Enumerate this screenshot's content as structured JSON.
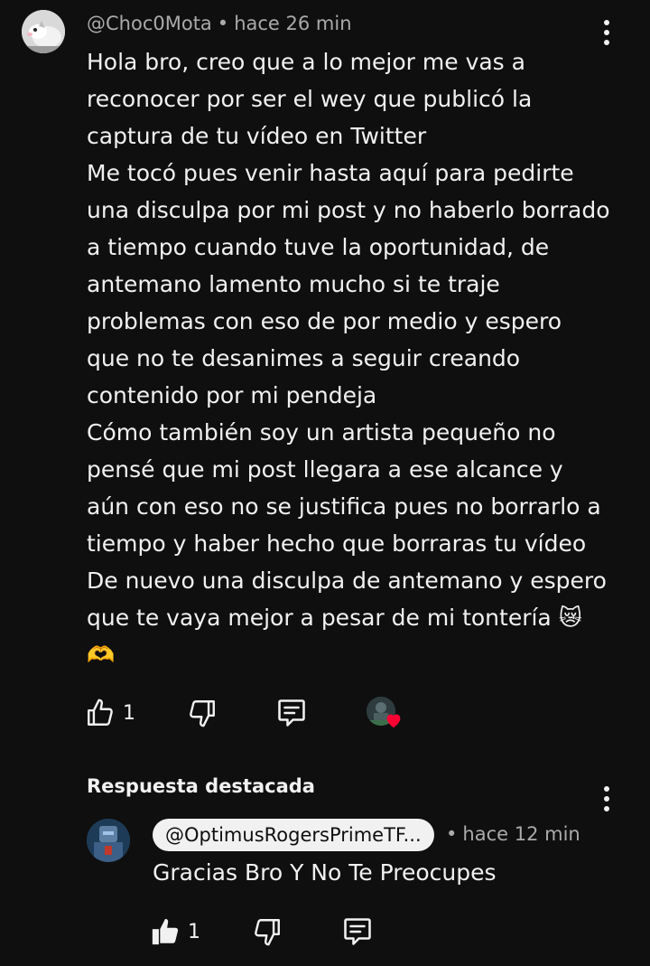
{
  "comment": {
    "author": "@Choc0Mota",
    "separator": "•",
    "time": "hace 26 min",
    "text": "Hola bro, creo que a lo mejor me vas a\nreconocer por ser el wey que publicó la\ncaptura de tu vídeo en Twitter\nMe tocó pues venir hasta aquí para pedirte\nuna disculpa por mi post y no haberlo borrado\na tiempo cuando tuve la oportunidad, de\nantemano lamento mucho si te traje\nproblemas con eso de por medio y espero\nque no te desanimes a seguir creando\ncontenido por mi pendeja\nCómo también soy un artista pequeño no\npensé que mi post llegara a ese alcance y\naún con eso no se justifica pues no borrarlo a\ntiempo y haber hecho que borraras tu vídeo\nDe nuevo una disculpa de antemano y espero\nque te vaya mejor a pesar de mi tontería 😿\n🫶",
    "like_count": "1",
    "icons": {
      "like": "thumbs-up-outline-icon",
      "dislike": "thumbs-down-outline-icon",
      "reply": "comment-icon",
      "menu": "more-vertical-icon",
      "creator_heart": "creator-heart-icon"
    }
  },
  "reply_section": {
    "label": "Respuesta destacada"
  },
  "reply": {
    "author": "@OptimusRogersPrimeTF...",
    "separator": "•",
    "time": "hace 12 min",
    "text": "Gracias Bro Y No Te Preocupes",
    "like_count": "1",
    "icons": {
      "like": "thumbs-up-filled-icon",
      "dislike": "thumbs-down-outline-icon",
      "reply": "comment-icon",
      "menu": "more-vertical-icon"
    }
  },
  "colors": {
    "background": "#0f0f0f",
    "text": "#f1f1f1",
    "secondary_text": "#aaaaaa",
    "heart": "#ff0033",
    "pill_bg": "#f1f1f1"
  }
}
